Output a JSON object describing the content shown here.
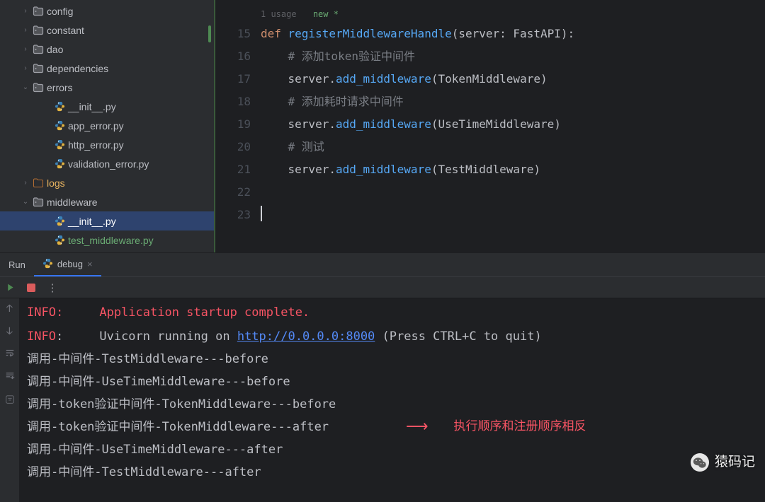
{
  "sidebar": {
    "items": [
      {
        "indent": 28,
        "arrow": "›",
        "kind": "folder",
        "label": "config"
      },
      {
        "indent": 28,
        "arrow": "›",
        "kind": "folder",
        "label": "constant"
      },
      {
        "indent": 28,
        "arrow": "›",
        "kind": "folder",
        "label": "dao"
      },
      {
        "indent": 28,
        "arrow": "›",
        "kind": "folder",
        "label": "dependencies"
      },
      {
        "indent": 28,
        "arrow": "⌄",
        "kind": "folder",
        "label": "errors"
      },
      {
        "indent": 58,
        "arrow": "",
        "kind": "py",
        "label": "__init__.py"
      },
      {
        "indent": 58,
        "arrow": "",
        "kind": "py",
        "label": "app_error.py"
      },
      {
        "indent": 58,
        "arrow": "",
        "kind": "py",
        "label": "http_error.py"
      },
      {
        "indent": 58,
        "arrow": "",
        "kind": "py",
        "label": "validation_error.py"
      },
      {
        "indent": 28,
        "arrow": "›",
        "kind": "folder-ex",
        "label": "logs",
        "vcs": "mod"
      },
      {
        "indent": 28,
        "arrow": "⌄",
        "kind": "folder",
        "label": "middleware"
      },
      {
        "indent": 58,
        "arrow": "",
        "kind": "py",
        "label": "__init__.py",
        "selected": true
      },
      {
        "indent": 58,
        "arrow": "",
        "kind": "py",
        "label": "test_middleware.py",
        "vcs": "new"
      }
    ]
  },
  "editor": {
    "hint_usage": "1 usage",
    "hint_new": "new *",
    "line_start": 15,
    "lines": [
      {
        "mod": true,
        "tokens": [
          [
            "kw",
            "def "
          ],
          [
            "fn",
            "registerMiddlewareHandle"
          ],
          [
            "punct",
            "("
          ],
          [
            "param",
            "server"
          ],
          [
            "punct",
            ": "
          ],
          [
            "type",
            "FastAPI"
          ],
          [
            "punct",
            "):"
          ]
        ]
      },
      {
        "tokens": [
          [
            "punct",
            "    "
          ],
          [
            "cmt",
            "# 添加token验证中间件"
          ]
        ]
      },
      {
        "tokens": [
          [
            "punct",
            "    server"
          ],
          [
            "punct",
            "."
          ],
          [
            "fn",
            "add_middleware"
          ],
          [
            "punct",
            "("
          ],
          [
            "type",
            "TokenMiddleware"
          ],
          [
            "punct",
            ")"
          ]
        ]
      },
      {
        "tokens": [
          [
            "punct",
            "    "
          ],
          [
            "cmt",
            "# 添加耗时请求中间件"
          ]
        ]
      },
      {
        "tokens": [
          [
            "punct",
            "    server"
          ],
          [
            "punct",
            "."
          ],
          [
            "fn",
            "add_middleware"
          ],
          [
            "punct",
            "("
          ],
          [
            "type",
            "UseTimeMiddleware"
          ],
          [
            "punct",
            ")"
          ]
        ]
      },
      {
        "tokens": [
          [
            "punct",
            "    "
          ],
          [
            "cmt",
            "# 测试"
          ]
        ]
      },
      {
        "tokens": [
          [
            "punct",
            "    server"
          ],
          [
            "punct",
            "."
          ],
          [
            "fn",
            "add_middleware"
          ],
          [
            "punct",
            "("
          ],
          [
            "type",
            "TestMiddleware"
          ],
          [
            "punct",
            ")"
          ]
        ]
      },
      {
        "tokens": []
      },
      {
        "caret": true,
        "tokens": []
      }
    ]
  },
  "run": {
    "panel_label": "Run",
    "tab_label": "debug"
  },
  "console": {
    "lines": [
      {
        "segments": [
          [
            "cut-top",
            "INFO:     Application startup complete."
          ]
        ]
      },
      {
        "segments": [
          [
            "info-red",
            "INFO"
          ],
          [
            "plain",
            ":     Uvicorn running on "
          ],
          [
            "url",
            "http://0.0.0.0:8000"
          ],
          [
            "plain",
            " (Press CTRL+C to quit)"
          ]
        ]
      },
      {
        "segments": [
          [
            "plain",
            "调用-中间件-TestMiddleware---before"
          ]
        ]
      },
      {
        "segments": [
          [
            "plain",
            "调用-中间件-UseTimeMiddleware---before"
          ]
        ]
      },
      {
        "segments": [
          [
            "plain",
            "调用-token验证中间件-TokenMiddleware---before"
          ]
        ]
      },
      {
        "segments": [
          [
            "plain",
            "调用-token验证中间件-TokenMiddleware---after"
          ]
        ]
      },
      {
        "segments": [
          [
            "plain",
            "调用-中间件-UseTimeMiddleware---after"
          ]
        ]
      },
      {
        "segments": [
          [
            "plain",
            "调用-中间件-TestMiddleware---after"
          ]
        ]
      }
    ],
    "annotation": "执行顺序和注册顺序相反"
  },
  "watermark": "猿码记"
}
